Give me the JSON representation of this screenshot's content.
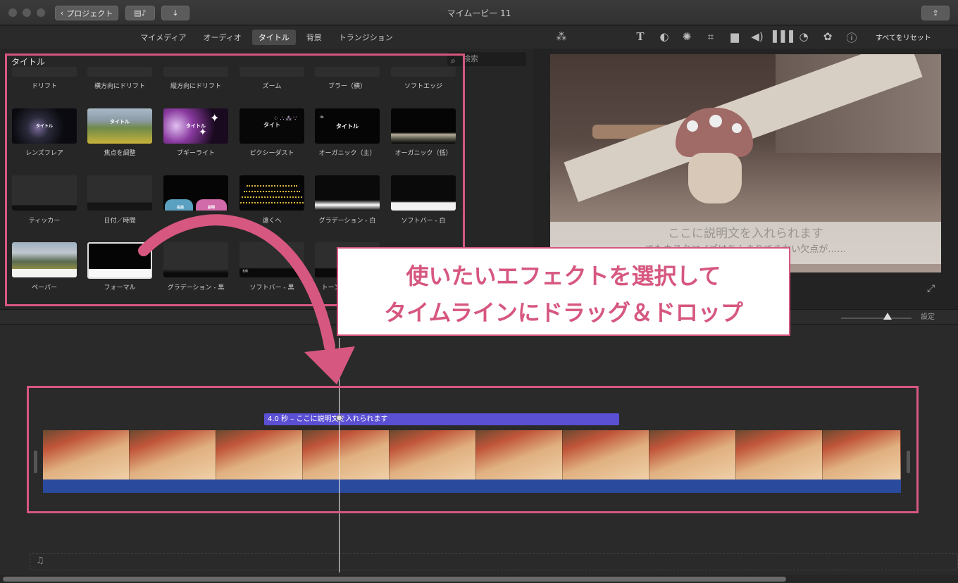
{
  "window": {
    "title": "マイムービー 11",
    "back_label": "プロジェクト"
  },
  "browser_tabs": [
    {
      "label": "マイメディア",
      "active": false
    },
    {
      "label": "オーディオ",
      "active": false
    },
    {
      "label": "タイトル",
      "active": true
    },
    {
      "label": "背景",
      "active": false
    },
    {
      "label": "トランジション",
      "active": false
    }
  ],
  "library": {
    "heading": "タイトル",
    "search_placeholder": "検索",
    "row0": [
      "ドリフト",
      "横方向にドリフト",
      "縦方向にドリフト",
      "ズーム",
      "ブラー（横）",
      "ソフトエッジ"
    ],
    "row1": [
      "レンズフレア",
      "焦点を調整",
      "ブギーライト",
      "ピクシーダスト",
      "オーガニック（主）",
      "オーガニック（低）"
    ],
    "row2": [
      "ティッカー",
      "日付／時間",
      "",
      "遠くへ",
      "グラデーション - 白",
      "ソフトバー - 白"
    ],
    "row3": [
      "ペーパー",
      "フォーマル",
      "グラデーション - 黒",
      "ソフトバー - 黒",
      "トーン"
    ],
    "thumb_captions": {
      "lensflare": "タイトル",
      "focus": "タイトル",
      "boogie": "タイトル",
      "pixie": "タイト",
      "organic": "タイトル",
      "cloud_a": "名前",
      "cloud_b": "説明",
      "softbar_black": "名前",
      "softbar_black2": "説明"
    }
  },
  "viewer": {
    "reset_label": "すべてをリセット",
    "subtitle_line1": "ここに説明文を入れられます",
    "subtitle_line2": "でもカスタマイズはあんまりできない欠点が……"
  },
  "timeline": {
    "settings_label": "設定",
    "title_clip_label": "4.0 秒 – ここに説明文を入れられます"
  },
  "annotation": {
    "line1": "使いたいエフェクトを選択して",
    "line2": "タイムラインにドラッグ＆ドロップ"
  },
  "colors": {
    "accent_pink": "#d6577f",
    "title_clip": "#5b4fd4",
    "audio_bar": "#2a4a9e"
  }
}
